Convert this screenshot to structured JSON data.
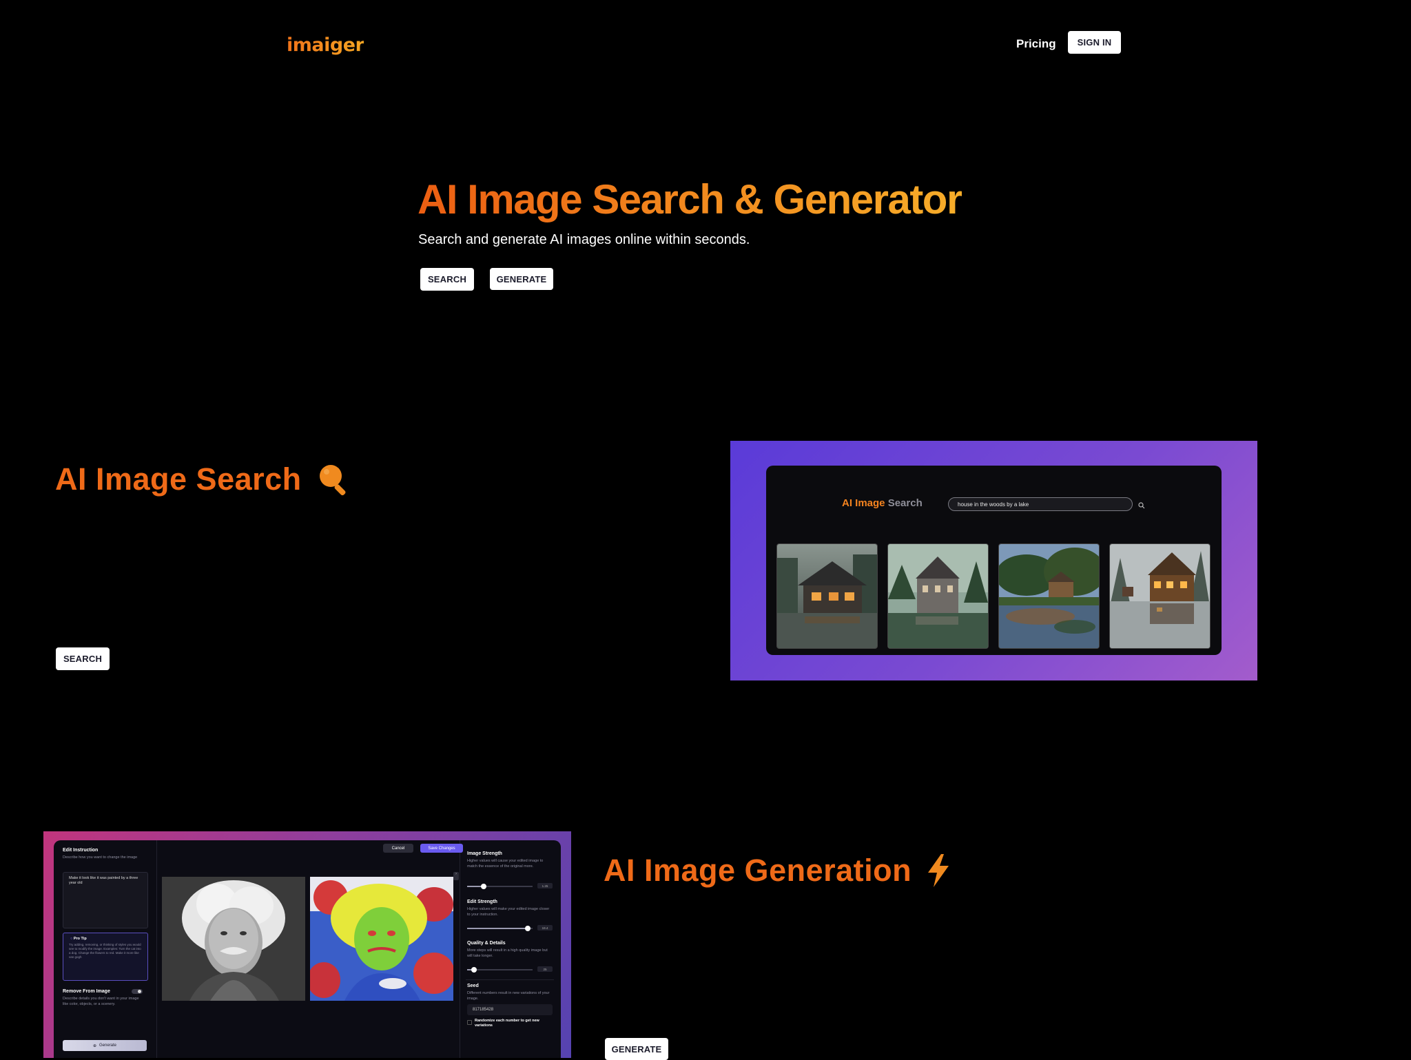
{
  "nav": {
    "logo": "imaiger",
    "pricing": "Pricing",
    "sign_in": "SIGN IN"
  },
  "hero": {
    "title": "AI Image Search & Generator",
    "subtitle": "Search and generate AI images online within seconds.",
    "search_button": "SEARCH",
    "generate_button": "GENERATE"
  },
  "search_section": {
    "title": "AI Image Search",
    "button": "SEARCH",
    "icon": "magnifier-icon",
    "preview": {
      "title_a": "AI Image",
      "title_b": "Search",
      "query": "house in the woods by a lake"
    }
  },
  "generation_section": {
    "title": "AI Image Generation",
    "button": "GENERATE",
    "icon": "lightning-icon",
    "preview": {
      "edit_instruction": "Edit Instruction",
      "edit_desc": "Describe how you want to change the image",
      "edit_text": "Make it look like it was painted by a three year old",
      "pro_tip": "Pro Tip",
      "pro_tip_text": "Try adding, removing, or thinking of styles you would see to modify the image. Examples: Turn the cat into a dog. Change the flowers to red. Make it more like van gogh",
      "remove_from_image": "Remove From Image",
      "remove_desc": "Describe details you don't want in your image like color, objects, or a scenery.",
      "generate": "Generate",
      "cancel": "Cancel",
      "save_changes": "Save Changes",
      "image_strength": "Image Strength",
      "image_strength_desc": "Higher values will cause your edited image to match the essence of the original more.",
      "image_strength_val": "1.25",
      "edit_strength": "Edit Strength",
      "edit_strength_desc": "Higher values will make your edited image closer to your instruction.",
      "edit_strength_val": "19.4",
      "quality": "Quality & Details",
      "quality_desc": "More steps will result in a high quality image but will take longer.",
      "quality_val": "25",
      "seed": "Seed",
      "seed_desc": "Different numbers result in new variations of your image.",
      "seed_val": "817185428",
      "randomize": "Randomize each number to get new variations"
    }
  },
  "colors": {
    "accent": "#ef6a18",
    "accent_light": "#f7ad29",
    "background": "#000000",
    "purple": "#6c45d6"
  }
}
